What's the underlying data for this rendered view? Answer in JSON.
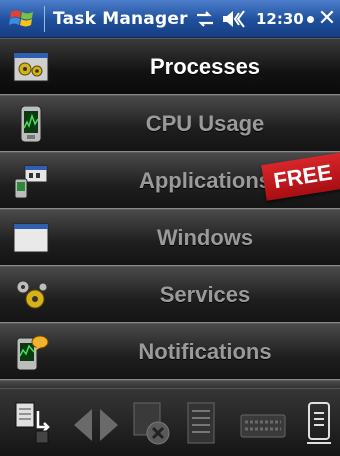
{
  "titlebar": {
    "app_title": "Task Manager",
    "time": "12:30",
    "close_glyph": "✕"
  },
  "menu": {
    "items": [
      {
        "label": "Processes",
        "icon": "processes-gear-window-icon",
        "selected": true
      },
      {
        "label": "CPU Usage",
        "icon": "cpu-usage-device-icon",
        "selected": false
      },
      {
        "label": "Applications",
        "icon": "applications-device-icon",
        "selected": false
      },
      {
        "label": "Windows",
        "icon": "window-icon",
        "selected": false
      },
      {
        "label": "Services",
        "icon": "services-gears-icon",
        "selected": false
      },
      {
        "label": "Notifications",
        "icon": "notifications-device-icon",
        "selected": false
      }
    ]
  },
  "banner": {
    "text": "FREE",
    "color": "#c8171c"
  },
  "toolbar": {
    "icons": [
      "switch-task-icon",
      "back-arrow-icon",
      "forward-arrow-icon",
      "end-task-icon",
      "list-icon",
      "keyboard-icon",
      "menu-device-icon"
    ]
  },
  "colors": {
    "titlebar": "#1e4f9c",
    "selected_text": "#ffffff",
    "inactive_text": "#9a9a9a"
  }
}
